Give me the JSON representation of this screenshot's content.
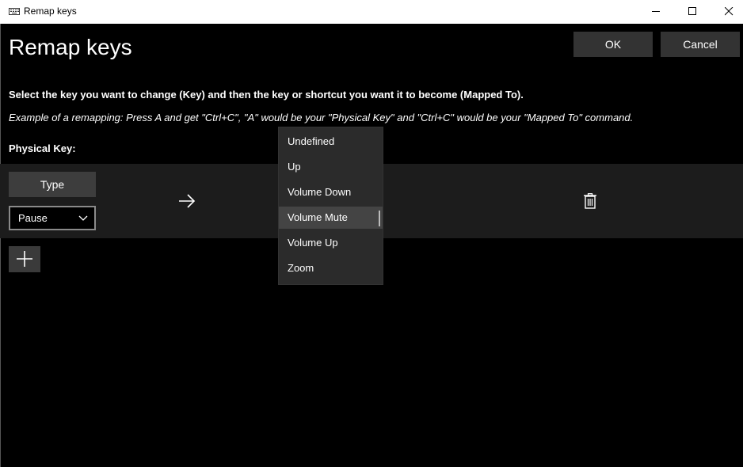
{
  "window": {
    "title": "Remap keys",
    "icon": "keyboard-icon",
    "controls": [
      "minimize-icon",
      "maximize-icon",
      "close-icon"
    ]
  },
  "header": {
    "title": "Remap keys",
    "ok_label": "OK",
    "cancel_label": "Cancel"
  },
  "instructions": "Select the key you want to change (Key) and then the key or shortcut you want it to become (Mapped To).",
  "example": "Example of a remapping: Press A and get \"Ctrl+C\", \"A\" would be your \"Physical Key\" and \"Ctrl+C\" would be your \"Mapped To\" command.",
  "columns": {
    "physical_key": "Physical Key:"
  },
  "mapping_row": {
    "type_label": "Type",
    "physical_key_value": "Pause",
    "arrow_icon": "arrow-right-icon",
    "delete_icon": "trash-icon"
  },
  "add_button_icon": "plus-icon",
  "dropdown": {
    "items": [
      "Undefined",
      "Up",
      "Volume Down",
      "Volume Mute",
      "Volume Up",
      "Zoom"
    ],
    "selected": "Volume Mute"
  },
  "colors": {
    "background": "#000000",
    "row_background": "#1c1c1c",
    "button": "#333333",
    "dropdown": "#2b2b2b",
    "dropdown_selected": "#444444"
  }
}
